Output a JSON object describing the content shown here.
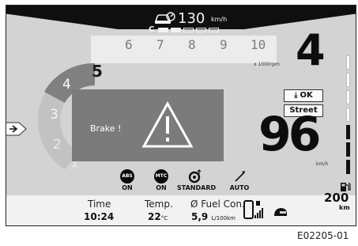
{
  "cruise": {
    "speed": "130",
    "unit": "km/h",
    "mode": "C",
    "level": 0.4
  },
  "rpm": {
    "scale": [
      "1",
      "2",
      "3",
      "4",
      "5",
      "6",
      "7",
      "8",
      "9",
      "10"
    ],
    "unit": "x 1000rpm",
    "current_scale": "5"
  },
  "gear": "4",
  "status": {
    "ok_label": "OK",
    "ride_mode": "Street"
  },
  "speed": {
    "value": "96",
    "unit": "km/h"
  },
  "alert": {
    "text": "Brake !"
  },
  "indicators": [
    {
      "badge": "ABS",
      "label": "ON"
    },
    {
      "badge": "MTC",
      "label": "ON"
    },
    {
      "label": "STANDARD"
    },
    {
      "label": "AUTO"
    }
  ],
  "info": {
    "time_label": "Time",
    "time_value": "10:24",
    "temp_label": "Temp.",
    "temp_value": "22",
    "temp_unit": "°C",
    "fuel_label": "Ø Fuel Con.",
    "fuel_value": "5,9",
    "fuel_unit": "L/100km"
  },
  "range": {
    "value": "200",
    "unit": "km"
  },
  "caption": "E02205-01",
  "colors": {
    "background": "#d3d3d3",
    "panel_dark": "#0f0f0f",
    "alert_gray": "#7b7b7b"
  }
}
